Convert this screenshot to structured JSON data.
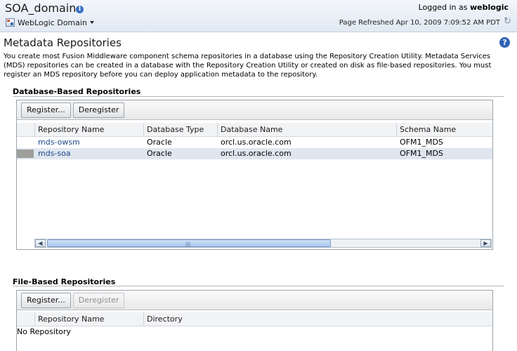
{
  "header": {
    "title": "SOA_domain",
    "domain_menu_label": "WebLogic Domain",
    "logged_in_prefix": "Logged in as",
    "logged_in_user": "weblogic",
    "page_refreshed": "Page Refreshed Apr 10, 2009 7:09:52 AM PDT"
  },
  "page": {
    "title": "Metadata Repositories",
    "description": "You create most Fusion Middleware component schema repositories in a database using the Repository Creation Utility. Metadata Services (MDS) repositories can be created in a database with the Repository Creation Utility or created on disk as file-based repositories. You must register an MDS repository before you can deploy application metadata to the repository."
  },
  "database_repos": {
    "section_title": "Database-Based Repositories",
    "register_label": "Register...",
    "deregister_label": "Deregister",
    "columns": [
      "Repository Name",
      "Database Type",
      "Database Name",
      "Schema Name"
    ],
    "rows": [
      {
        "name": "mds-owsm",
        "db_type": "Oracle",
        "db_name": "orcl.us.oracle.com",
        "schema": "OFM1_MDS",
        "selected": false
      },
      {
        "name": "mds-soa",
        "db_type": "Oracle",
        "db_name": "orcl.us.oracle.com",
        "schema": "OFM1_MDS",
        "selected": true
      }
    ]
  },
  "file_repos": {
    "section_title": "File-Based Repositories",
    "register_label": "Register...",
    "deregister_label": "Deregister",
    "columns": [
      "Repository Name",
      "Directory"
    ],
    "empty_message": "No Repository"
  },
  "icons": {
    "info": "info-icon",
    "help": "help-icon",
    "refresh": "refresh-icon",
    "domain": "weblogic-domain-icon"
  },
  "colors": {
    "link": "#1d4a8a",
    "selected_row": "#dfe6ef",
    "header_band": "#e1e9f3"
  }
}
